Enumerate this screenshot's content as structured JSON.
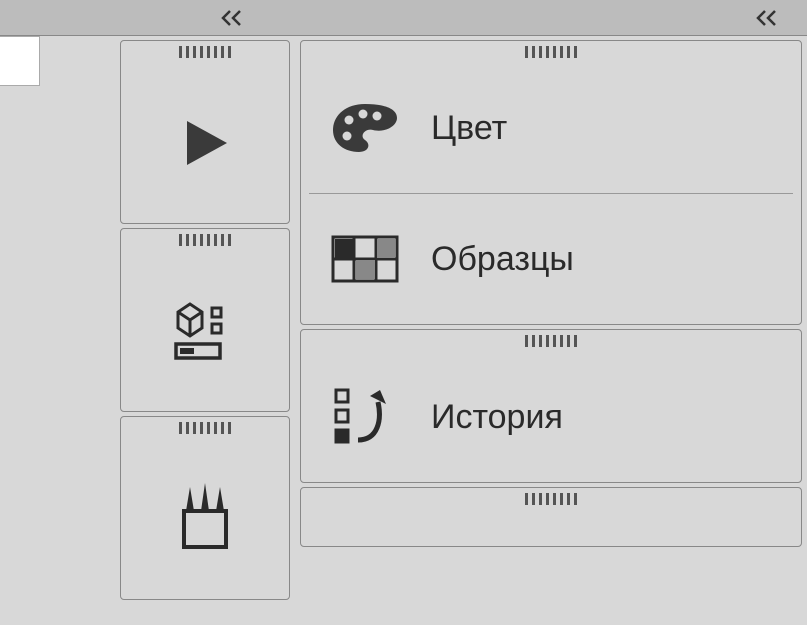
{
  "topbar": {
    "collapse_icon": "double-chevron-left-icon"
  },
  "left_panels": [
    {
      "icon": "play-icon"
    },
    {
      "icon": "3d-settings-icon"
    },
    {
      "icon": "brushes-icon"
    }
  ],
  "right_panels": [
    {
      "rows": [
        {
          "icon": "palette-icon",
          "label": "Цвет"
        },
        {
          "icon": "swatches-icon",
          "label": "Образцы"
        }
      ]
    },
    {
      "rows": [
        {
          "icon": "history-icon",
          "label": "История"
        }
      ]
    },
    {
      "partial": true,
      "rows": []
    }
  ]
}
